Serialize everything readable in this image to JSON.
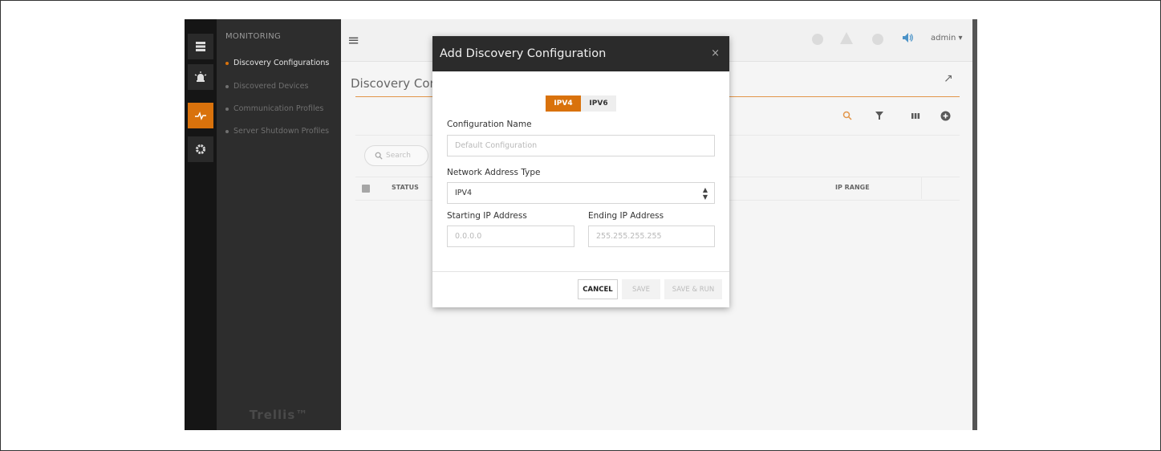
{
  "nav": {
    "section_title": "MONITORING",
    "items": [
      {
        "label": "Discovery Configurations",
        "active": true
      },
      {
        "label": "Discovered Devices",
        "active": false
      },
      {
        "label": "Communication Profiles",
        "active": false
      },
      {
        "label": "Server Shutdown Profiles",
        "active": false
      }
    ],
    "brand": "Trellis™"
  },
  "rail": {
    "icons": [
      "server-icon",
      "alarm-icon",
      "pulse-icon",
      "gear-icon"
    ],
    "active_index": 2,
    "accent": "#d9720c"
  },
  "topbar": {
    "menu_icon": "≡",
    "user_label": "admin ▾",
    "status_icons": [
      "circle-icon",
      "triangle-icon",
      "circle-icon",
      "speaker-icon"
    ]
  },
  "page": {
    "title": "Discovery Con",
    "expand_icon": "↗",
    "search_placeholder": "Search",
    "columns": [
      "STATUS",
      "IP RANGE"
    ],
    "tools": [
      "search-icon",
      "filter-icon",
      "columns-icon",
      "add-icon"
    ]
  },
  "modal": {
    "title": "Add Discovery Configuration",
    "close": "×",
    "tabs": [
      {
        "label": "IPV4",
        "selected": true
      },
      {
        "label": "IPV6",
        "selected": false
      }
    ],
    "config_name_label": "Configuration Name",
    "config_name_placeholder": "Default Configuration",
    "address_type_label": "Network Address Type",
    "address_type_value": "IPV4",
    "start_ip_label": "Starting IP Address",
    "start_ip_placeholder": "0.0.0.0",
    "end_ip_label": "Ending IP Address",
    "end_ip_placeholder": "255.255.255.255",
    "buttons": {
      "cancel": "CANCEL",
      "save": "SAVE",
      "save_run": "SAVE & RUN"
    }
  }
}
